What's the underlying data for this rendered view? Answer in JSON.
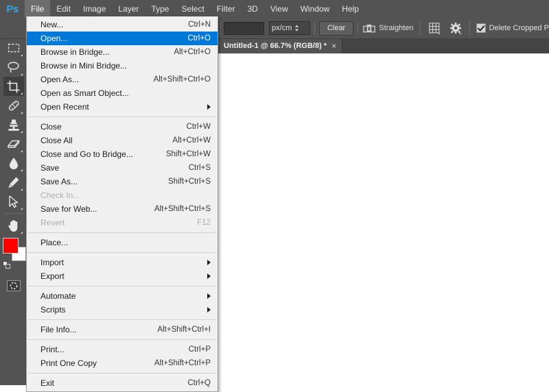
{
  "app": {
    "name": "Adobe Photoshop",
    "logo_text": "Ps",
    "logo_color": "#31a8e0",
    "accent_highlight": "#0078d7",
    "chrome_bg": "#535353",
    "menu_bg": "#f0f0f0"
  },
  "menubar": {
    "items": [
      {
        "label": "File",
        "active": true
      },
      {
        "label": "Edit",
        "active": false
      },
      {
        "label": "Image",
        "active": false
      },
      {
        "label": "Layer",
        "active": false
      },
      {
        "label": "Type",
        "active": false
      },
      {
        "label": "Select",
        "active": false
      },
      {
        "label": "Filter",
        "active": false
      },
      {
        "label": "3D",
        "active": false
      },
      {
        "label": "View",
        "active": false
      },
      {
        "label": "Window",
        "active": false
      },
      {
        "label": "Help",
        "active": false
      }
    ]
  },
  "file_menu": {
    "groups": [
      {
        "items": [
          {
            "label": "New...",
            "accel": "Ctrl+N",
            "state": "normal",
            "submenu": false
          },
          {
            "label": "Open...",
            "accel": "Ctrl+O",
            "state": "highlighted",
            "submenu": false
          },
          {
            "label": "Browse in Bridge...",
            "accel": "Alt+Ctrl+O",
            "state": "normal",
            "submenu": false
          },
          {
            "label": "Browse in Mini Bridge...",
            "accel": "",
            "state": "normal",
            "submenu": false
          },
          {
            "label": "Open As...",
            "accel": "Alt+Shift+Ctrl+O",
            "state": "normal",
            "submenu": false
          },
          {
            "label": "Open as Smart Object...",
            "accel": "",
            "state": "normal",
            "submenu": false
          },
          {
            "label": "Open Recent",
            "accel": "",
            "state": "normal",
            "submenu": true
          }
        ]
      },
      {
        "items": [
          {
            "label": "Close",
            "accel": "Ctrl+W",
            "state": "normal",
            "submenu": false
          },
          {
            "label": "Close All",
            "accel": "Alt+Ctrl+W",
            "state": "normal",
            "submenu": false
          },
          {
            "label": "Close and Go to Bridge...",
            "accel": "Shift+Ctrl+W",
            "state": "normal",
            "submenu": false
          },
          {
            "label": "Save",
            "accel": "Ctrl+S",
            "state": "normal",
            "submenu": false
          },
          {
            "label": "Save As...",
            "accel": "Shift+Ctrl+S",
            "state": "normal",
            "submenu": false
          },
          {
            "label": "Check In...",
            "accel": "",
            "state": "disabled",
            "submenu": false
          },
          {
            "label": "Save for Web...",
            "accel": "Alt+Shift+Ctrl+S",
            "state": "normal",
            "submenu": false
          },
          {
            "label": "Revert",
            "accel": "F12",
            "state": "disabled",
            "submenu": false
          }
        ]
      },
      {
        "items": [
          {
            "label": "Place...",
            "accel": "",
            "state": "normal",
            "submenu": false
          }
        ]
      },
      {
        "items": [
          {
            "label": "Import",
            "accel": "",
            "state": "normal",
            "submenu": true
          },
          {
            "label": "Export",
            "accel": "",
            "state": "normal",
            "submenu": true
          }
        ]
      },
      {
        "items": [
          {
            "label": "Automate",
            "accel": "",
            "state": "normal",
            "submenu": true
          },
          {
            "label": "Scripts",
            "accel": "",
            "state": "normal",
            "submenu": true
          }
        ]
      },
      {
        "items": [
          {
            "label": "File Info...",
            "accel": "Alt+Shift+Ctrl+I",
            "state": "normal",
            "submenu": false
          }
        ]
      },
      {
        "items": [
          {
            "label": "Print...",
            "accel": "Ctrl+P",
            "state": "normal",
            "submenu": false
          },
          {
            "label": "Print One Copy",
            "accel": "Alt+Shift+Ctrl+P",
            "state": "normal",
            "submenu": false
          }
        ]
      },
      {
        "items": [
          {
            "label": "Exit",
            "accel": "Ctrl+Q",
            "state": "normal",
            "submenu": false
          }
        ]
      }
    ]
  },
  "options_bar": {
    "tool_icon": "crop-tool-icon",
    "width_value": "",
    "height_value": "",
    "unit_select": "px/cm",
    "clear_label": "Clear",
    "straighten_icon": "straighten-icon",
    "straighten_label": "Straighten",
    "grid_overlay_icon": "crop-overlay-grid-icon",
    "settings_icon": "gear-icon",
    "delete_cropped_label": "Delete Cropped P",
    "delete_cropped_checked": true
  },
  "tabs": {
    "documents": [
      {
        "title": "Untitled-1 @ 66.7% (RGB/8) *",
        "close_glyph": "×",
        "active": true
      }
    ]
  },
  "tool_panel": {
    "collapse_glyph": "««",
    "tools": [
      {
        "name": "rectangular-marquee-tool",
        "glyph": "marquee",
        "selected": false,
        "has_flyout": true
      },
      {
        "name": "lasso-tool",
        "glyph": "lasso",
        "selected": false,
        "has_flyout": true
      },
      {
        "name": "crop-tool",
        "glyph": "crop",
        "selected": true,
        "has_flyout": true
      },
      {
        "name": "spot-healing-brush-tool",
        "glyph": "bandaid",
        "selected": false,
        "has_flyout": true
      },
      {
        "name": "clone-stamp-tool",
        "glyph": "stamp",
        "selected": false,
        "has_flyout": true
      },
      {
        "name": "eraser-tool",
        "glyph": "eraser",
        "selected": false,
        "has_flyout": true
      },
      {
        "name": "gradient-tool",
        "glyph": "droplet",
        "selected": false,
        "has_flyout": true
      },
      {
        "name": "pen-tool",
        "glyph": "pen",
        "selected": false,
        "has_flyout": true
      },
      {
        "name": "path-selection-tool",
        "glyph": "arrow",
        "selected": false,
        "has_flyout": true
      },
      {
        "name": "hand-tool",
        "glyph": "hand",
        "selected": false,
        "has_flyout": true
      }
    ],
    "foreground_color": "#fe0000",
    "background_color": "#ffffff",
    "quick_mask_icon": "quick-mask-icon"
  }
}
